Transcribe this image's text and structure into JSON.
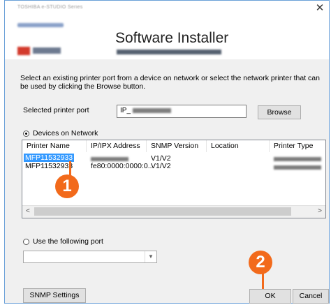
{
  "window": {
    "title": "TOSHIBA e-STUDIO Series",
    "close_symbol": "✕"
  },
  "header": {
    "title": "Software Installer"
  },
  "instructions": "Select an existing printer port from a device on network or select the network printer that can be used by clicking the Browse button.",
  "port": {
    "label": "Selected printer port",
    "value": "IP_",
    "browse_label": "Browse"
  },
  "network": {
    "radio_label": "Devices on Network",
    "columns": [
      "Printer Name",
      "IP/IPX Address",
      "SNMP Version",
      "Location",
      "Printer Type"
    ],
    "rows": [
      {
        "name": "MFP11532933",
        "address": "",
        "snmp": "V1/V2"
      },
      {
        "name": "MFP11532933",
        "address": "fe80:0000:0000:0...",
        "snmp": "V1/V2"
      }
    ],
    "scroll_left": "<",
    "scroll_right": ">"
  },
  "following_port": {
    "radio_label": "Use the following port"
  },
  "buttons": {
    "snmp": "SNMP Settings",
    "ok": "OK",
    "cancel": "Cancel"
  },
  "callouts": {
    "one": "1",
    "two": "2"
  },
  "colors": {
    "accent": "#f26a1b",
    "selection": "#3399ff"
  }
}
